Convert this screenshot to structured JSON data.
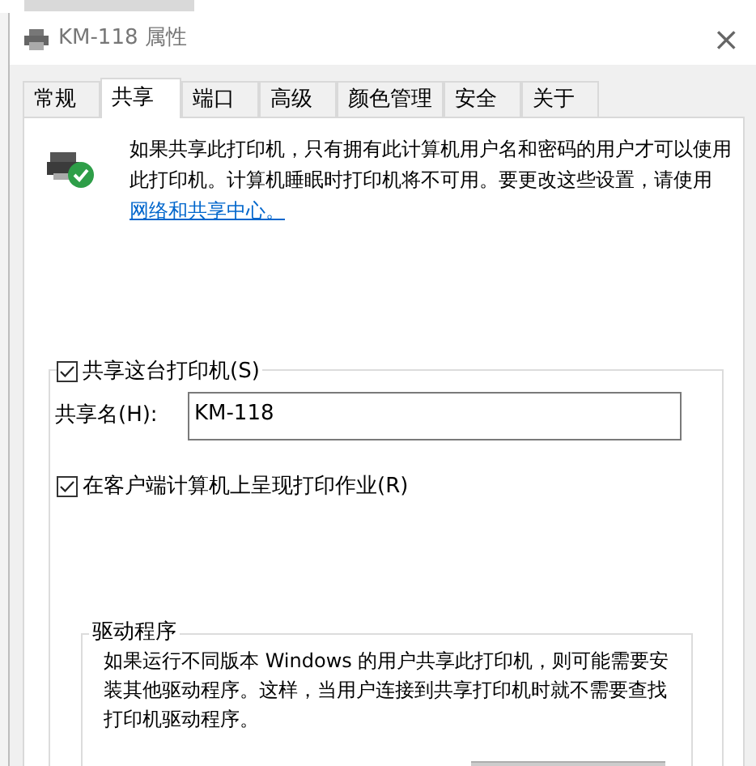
{
  "window": {
    "title": "KM-118 属性",
    "close": "×"
  },
  "tabs": [
    {
      "label": "常规",
      "selected": false
    },
    {
      "label": "共享",
      "selected": true
    },
    {
      "label": "端口",
      "selected": false
    },
    {
      "label": "高级",
      "selected": false
    },
    {
      "label": "颜色管理",
      "selected": false
    },
    {
      "label": "安全",
      "selected": false
    },
    {
      "label": "关于",
      "selected": false
    }
  ],
  "info": {
    "text": "如果共享此打印机，只有拥有此计算机用户名和密码的用户才可以使用此打印机。计算机睡眠时打印机将不可用。要更改这些设置，请使用",
    "link": "网络和共享中心。"
  },
  "share": {
    "label": "共享这台打印机(S)",
    "checked": true,
    "name_label": "共享名(H):",
    "name_value": "KM-118"
  },
  "render": {
    "label": "在客户端计算机上呈现打印作业(R)",
    "checked": true
  },
  "drivers": {
    "title": "驱动程序",
    "text": "如果运行不同版本 Windows 的用户共享此打印机，则可能需要安装其他驱动程序。这样，当用户连接到共享打印机时就不需要查找打印机驱动程序。"
  }
}
